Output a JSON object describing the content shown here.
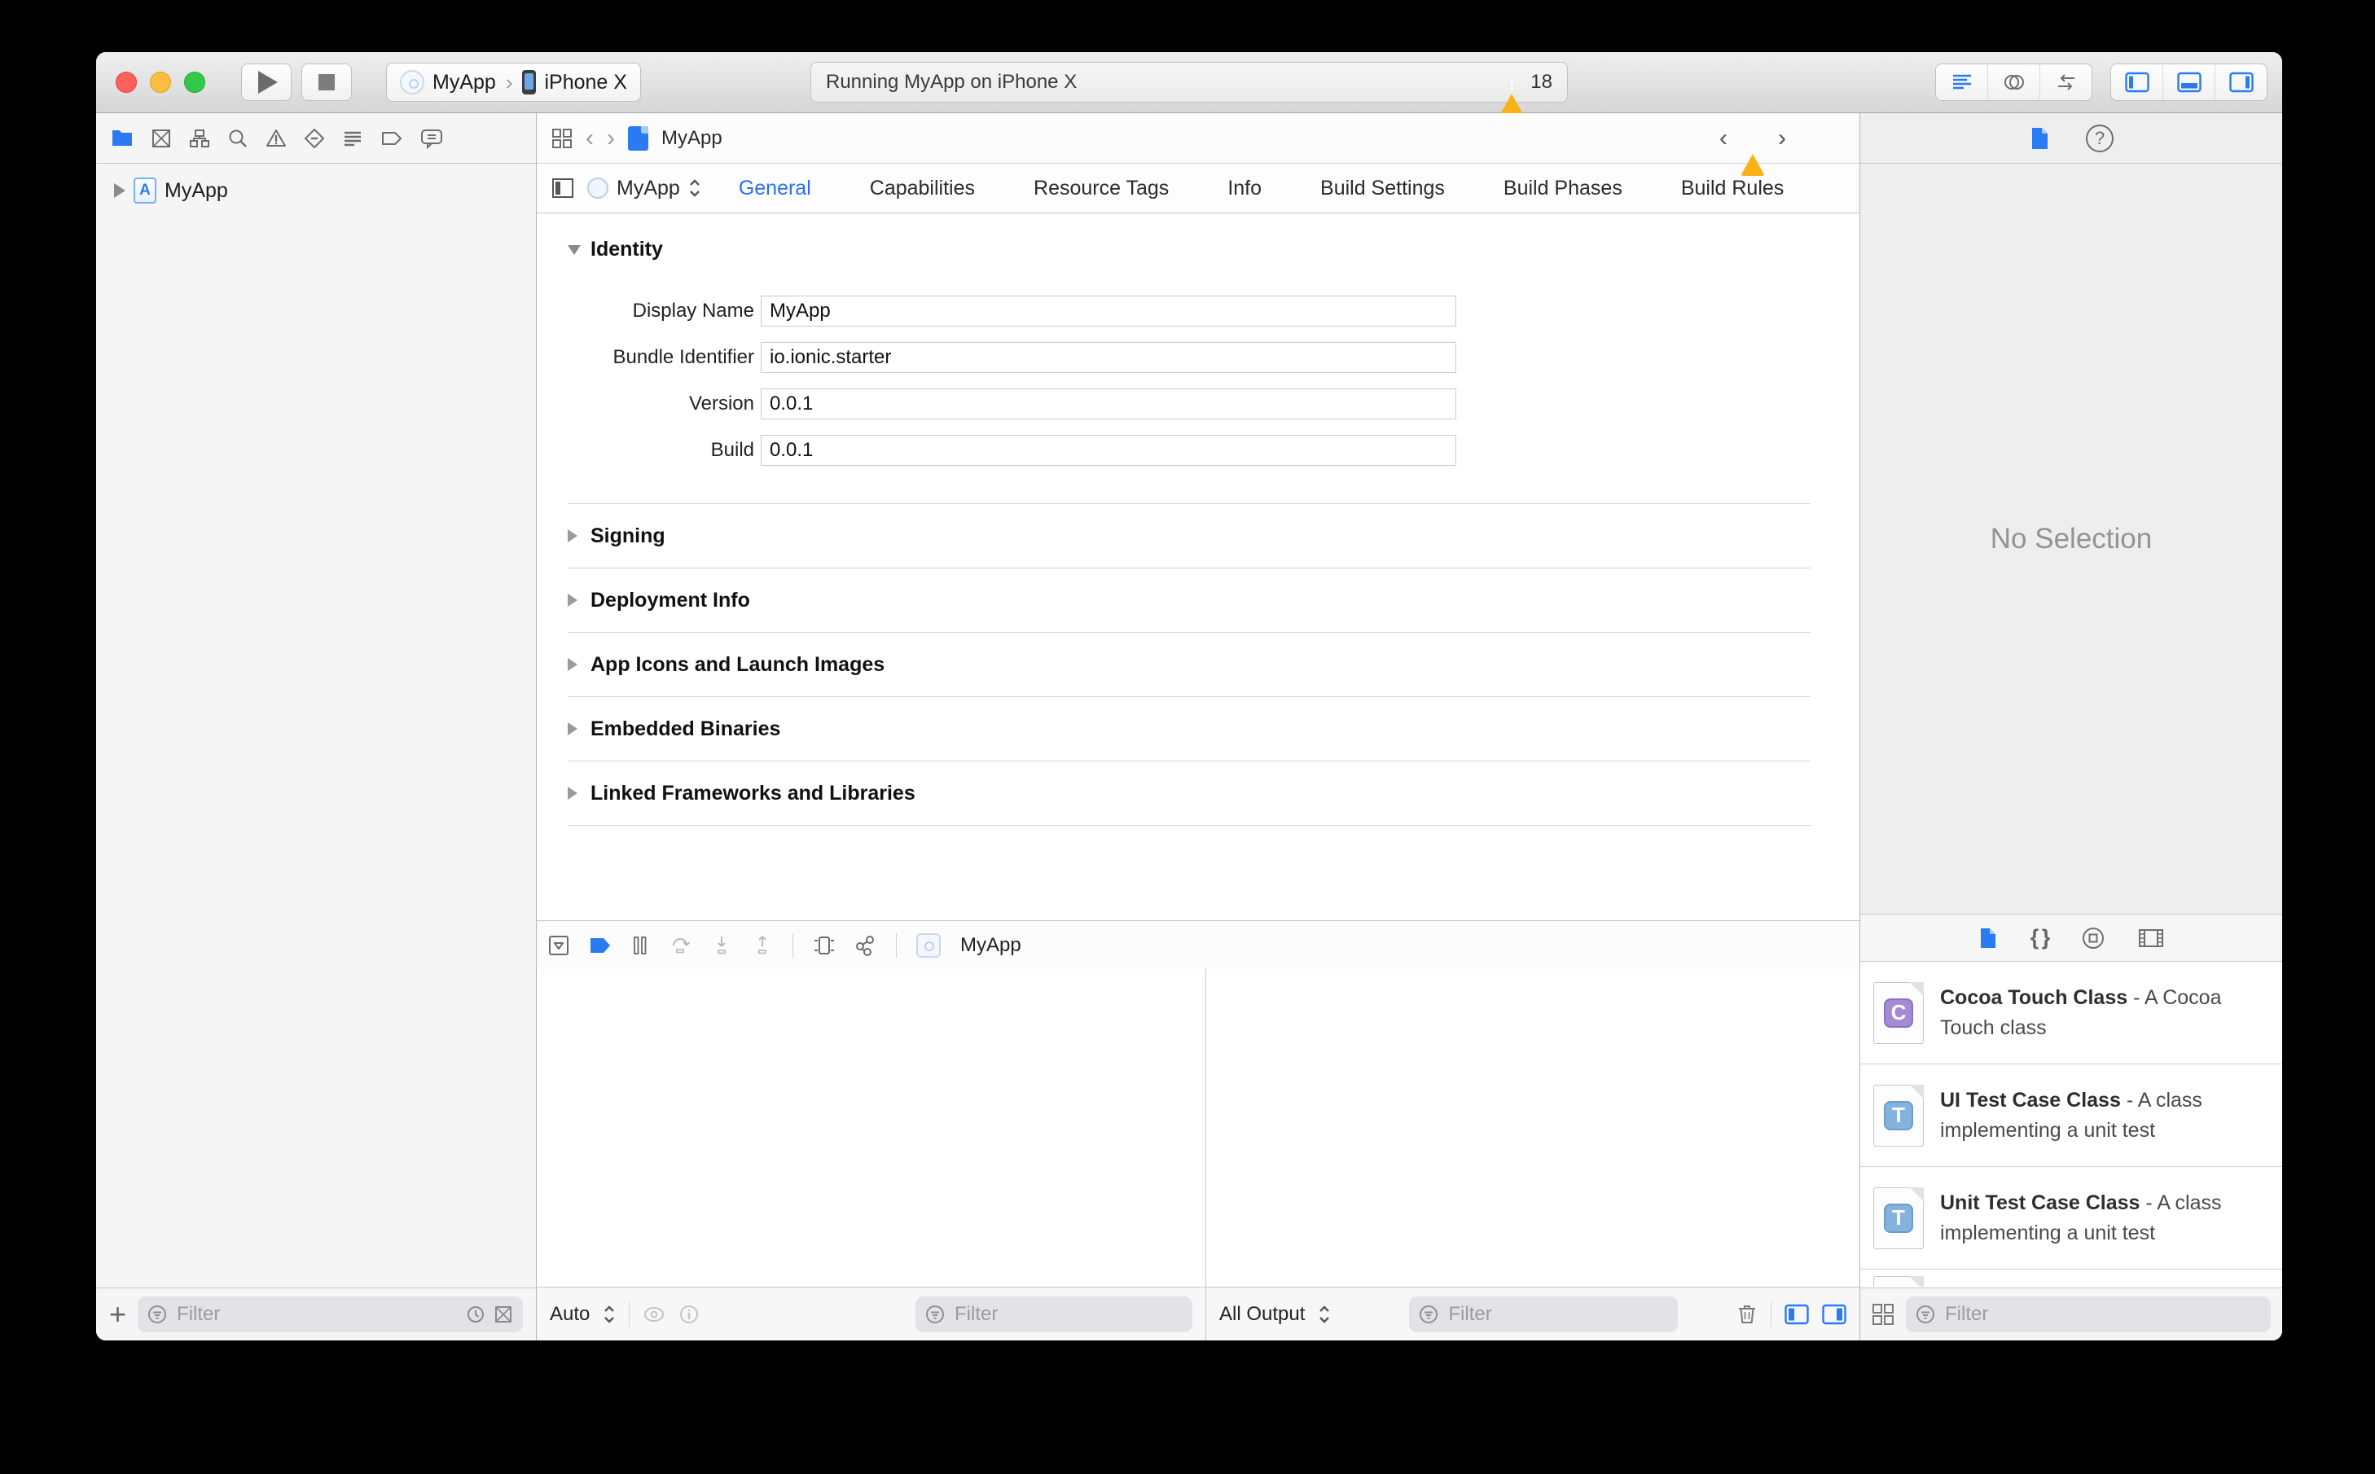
{
  "titlebar": {
    "status_text": "Running MyApp on iPhone X",
    "warning_count": "18",
    "scheme_project": "MyApp",
    "scheme_device": "iPhone X"
  },
  "icons": {
    "plus": "+",
    "help": "?",
    "braces": "{ }",
    "exclaim": "!",
    "chevron_left": "‹",
    "chevron_right": "›",
    "chevron_sep": "›"
  },
  "navigator": {
    "project_item": "MyApp",
    "filter_placeholder": "Filter"
  },
  "jump_bar": {
    "file_name": "MyApp"
  },
  "editor": {
    "target_name": "MyApp",
    "tabs": [
      {
        "label": "General",
        "active": true
      },
      {
        "label": "Capabilities",
        "active": false
      },
      {
        "label": "Resource Tags",
        "active": false
      },
      {
        "label": "Info",
        "active": false
      },
      {
        "label": "Build Settings",
        "active": false
      },
      {
        "label": "Build Phases",
        "active": false
      },
      {
        "label": "Build Rules",
        "active": false
      }
    ],
    "identity_section": "Identity",
    "identity_fields": [
      {
        "label": "Display Name",
        "value": "MyApp"
      },
      {
        "label": "Bundle Identifier",
        "value": "io.ionic.starter"
      },
      {
        "label": "Version",
        "value": "0.0.1"
      },
      {
        "label": "Build",
        "value": "0.0.1"
      }
    ],
    "collapsed_sections": [
      "Signing",
      "Deployment Info",
      "App Icons and Launch Images",
      "Embedded Binaries",
      "Linked Frameworks and Libraries"
    ]
  },
  "debug": {
    "target_name": "MyApp",
    "variables_scope": "Auto",
    "console_scope": "All Output",
    "variables_filter_placeholder": "Filter",
    "console_filter_placeholder": "Filter"
  },
  "inspector": {
    "empty_text": "No Selection",
    "filter_placeholder": "Filter",
    "library_items": [
      {
        "title": "Cocoa Touch Class",
        "description": "- A Cocoa Touch class",
        "badge": "C"
      },
      {
        "title": "UI Test Case Class",
        "description": "- A class implementing a unit test",
        "badge": "T"
      },
      {
        "title": "Unit Test Case Class",
        "description": "- A class implementing a unit test",
        "badge": "T"
      }
    ]
  },
  "colors": {
    "accent": "#2a7af2",
    "tab_active": "#2a6ff2",
    "warning_yellow": "#f7b318",
    "badge_purple": "#a58bd3",
    "badge_blue": "#85b3e0"
  }
}
